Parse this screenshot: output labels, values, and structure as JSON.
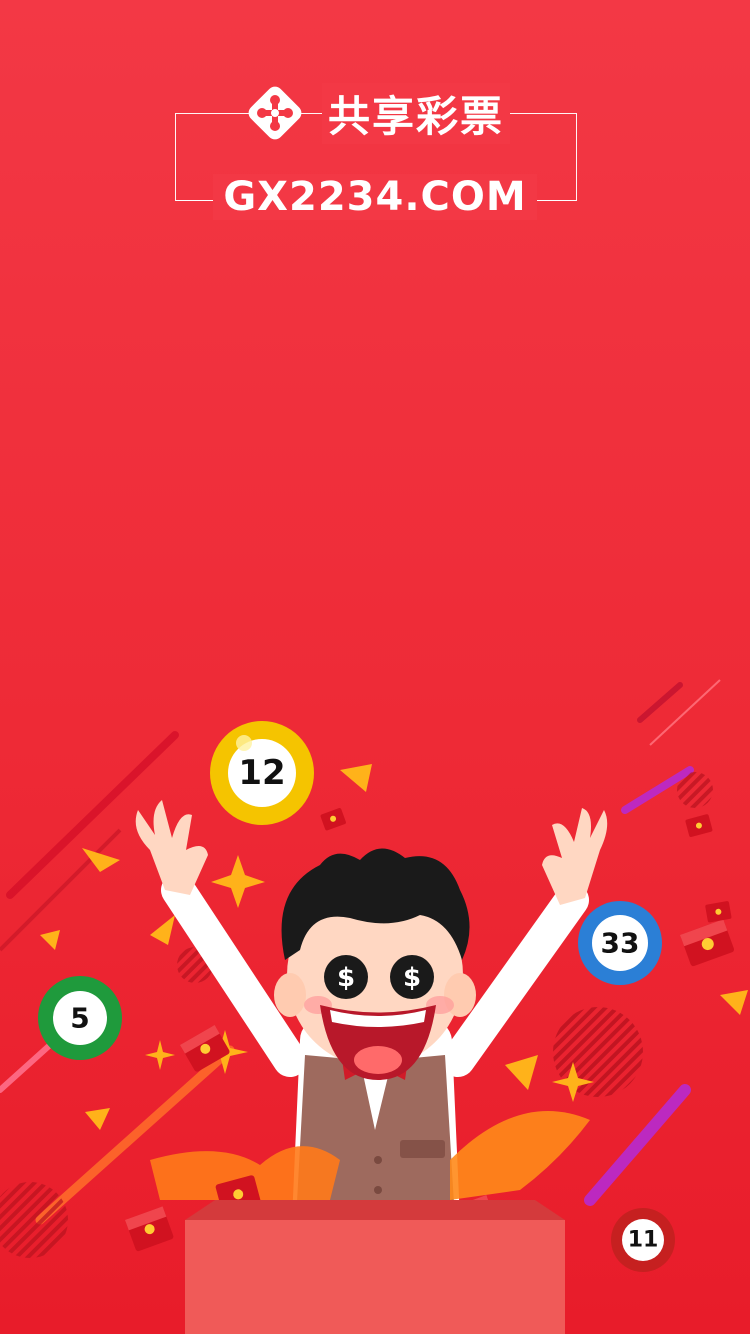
{
  "brand": {
    "name": "共享彩票",
    "url": "GX2234.COM",
    "logo_icon": "puzzle-logo-icon"
  },
  "lottery_balls": [
    {
      "number": "12",
      "color": "#f5c400"
    },
    {
      "number": "33",
      "color": "#2b7fd6"
    },
    {
      "number": "5",
      "color": "#1f9a3c"
    },
    {
      "number": "11",
      "color": "#c62020"
    }
  ],
  "colors": {
    "background_top": "#f33845",
    "background_bottom": "#e81c2a",
    "accent_gold": "#ffcc33"
  }
}
